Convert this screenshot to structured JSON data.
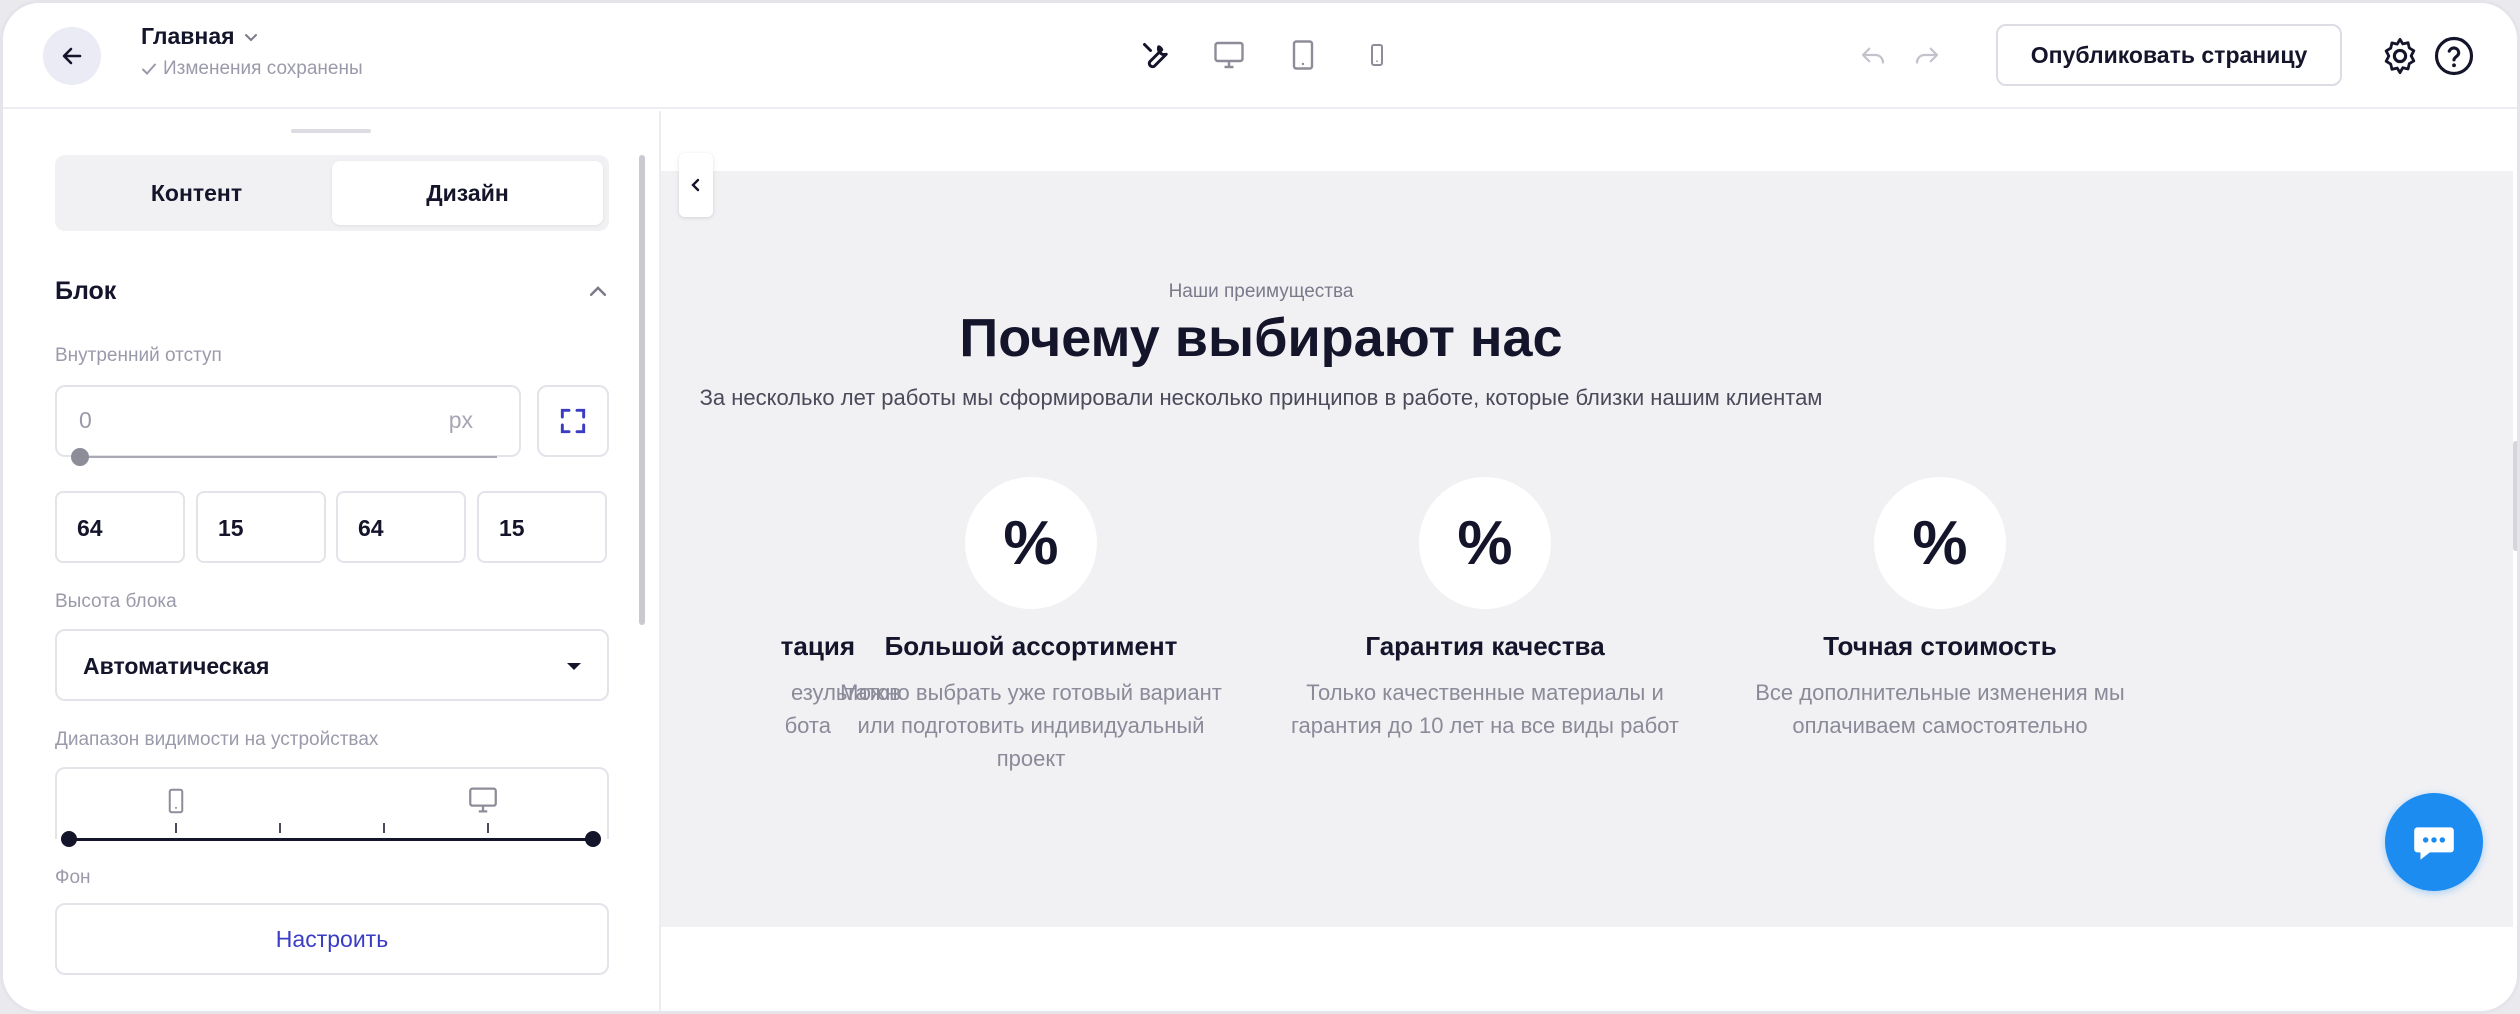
{
  "topbar": {
    "page_title": "Главная",
    "saved_status": "Изменения сохранены",
    "publish_label": "Опубликовать страницу"
  },
  "left_panel": {
    "tabs": [
      {
        "label": "Контент",
        "active": false
      },
      {
        "label": "Дизайн",
        "active": true
      }
    ],
    "section_title": "Блок",
    "inner_padding_label": "Внутренний отступ",
    "inner_padding_value": "0",
    "inner_padding_unit": "px",
    "padding_values": [
      "64",
      "15",
      "64",
      "15"
    ],
    "block_height_label": "Высота блока",
    "block_height_value": "Автоматическая",
    "visibility_label": "Диапазон видимости на устройствах",
    "background_label": "Фон",
    "background_button": "Настроить"
  },
  "canvas": {
    "eyebrow": "Наши преимущества",
    "headline": "Почему выбирают нас",
    "subline": "За несколько лет работы мы сформировали несколько принципов в работе, которые близки нашим клиентам",
    "features": [
      {
        "icon": "%",
        "title": "тация",
        "desc_line1": "езультатов",
        "desc_line2": "бота",
        "desc_line3": ""
      },
      {
        "icon": "%",
        "title": "Большой ассортимент",
        "desc_line1": "Можно выбрать уже готовый вариант",
        "desc_line2": "или подготовить индивидуальный",
        "desc_line3": "проект"
      },
      {
        "icon": "%",
        "title": "Гарантия качества",
        "desc_line1": "Только качественные материалы и",
        "desc_line2": "гарантия до 10 лет на все виды работ",
        "desc_line3": ""
      },
      {
        "icon": "%",
        "title": "Точная стоимость",
        "desc_line1": "Все дополнительные изменения мы",
        "desc_line2": "оплачиваем самостоятельно",
        "desc_line3": ""
      }
    ]
  },
  "colors": {
    "accent": "#3a3dc4",
    "chat": "#1d8cf0",
    "block_bg": "#f1f1f4"
  },
  "icons": [
    "arrow-left-icon",
    "chevron-down-icon",
    "check-icon",
    "wrench-icon",
    "desktop-icon",
    "tablet-icon",
    "mobile-icon",
    "undo-icon",
    "redo-icon",
    "gear-icon",
    "help-icon",
    "chevron-up-icon",
    "expand-icon",
    "chevron-left-icon",
    "chat-icon"
  ]
}
